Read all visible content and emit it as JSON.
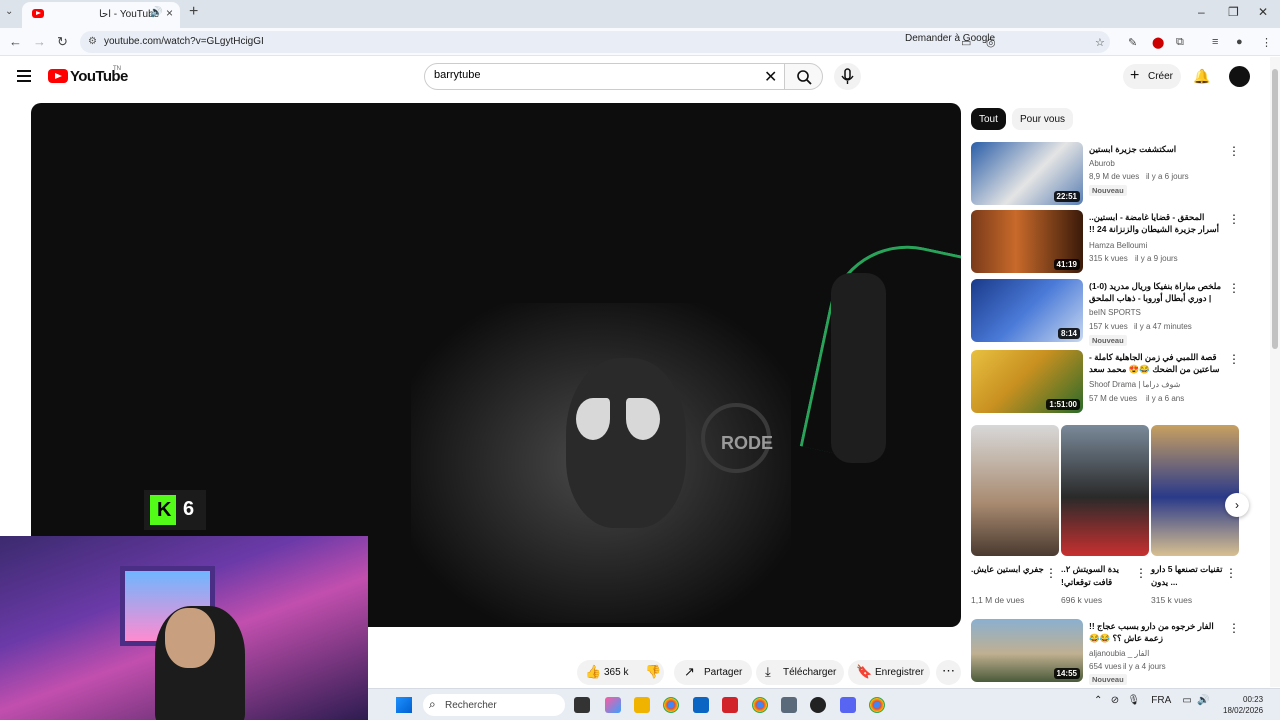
{
  "browser": {
    "tab_title": "YouTube - احا",
    "url": "youtube.com/watch?v=GLgytHcigGI",
    "ask_google": "Demander à Google"
  },
  "youtube": {
    "logo_text": "YouTube",
    "country_code": "TN",
    "search_value": "barrytube",
    "create_label": "Créer"
  },
  "video": {
    "overlay_counter": "6",
    "mic_brand": "RODE"
  },
  "actions": {
    "likes": "365 k",
    "share": "Partager",
    "download": "Télécharger",
    "save": "Enregistrer"
  },
  "chips": [
    "Tout",
    "Pour vous"
  ],
  "recommendations": [
    {
      "title": "اسكتشفت جزيرة ابستين",
      "channel": "Aburob",
      "verified": true,
      "views": "8,9 M de vues",
      "age": "il y a 6 jours",
      "duration": "22:51",
      "badge": "Nouveau"
    },
    {
      "title": "المحقق - قضايا غامضة - ابستين.. أسرار جزيرة الشيطان والزنزانة 24 !!",
      "channel": "Hamza Belloumi",
      "verified": true,
      "views": "315 k vues",
      "age": "il y a 9 jours",
      "duration": "41:19",
      "badge": ""
    },
    {
      "title": "ملخص مباراة بنفيكا وريال مدريد (0-1) | دوري أبطال أوروبا - ذهاب الملحق المؤهل...",
      "channel": "beIN SPORTS",
      "verified": true,
      "views": "157 k vues",
      "age": "il y a 47 minutes",
      "duration": "8:14",
      "badge": "Nouveau"
    },
    {
      "title": "قصة اللمبي في زمن الجاهلية كاملة - ساعتين من الضحك 😂😍 محمد سعد - فيلم اطاط",
      "channel": "Shoof Drama | شوف دراما",
      "verified": true,
      "views": "57 M de vues",
      "age": "il y a 6 ans",
      "duration": "1:51:00",
      "badge": ""
    }
  ],
  "shorts": [
    {
      "title": "جفري ابستين عايش.",
      "views": "1,1 M de vues"
    },
    {
      "title": "يدة السويتش ٢.. قافت توقعاتي!",
      "views": "696 k vues"
    },
    {
      "title": "تقنيات تصنعها 5 دارو ... يدون",
      "views": "315 k vues"
    }
  ],
  "last_recommendation": {
    "title": "الفار خرجوه من دارو بسبب عجاج !! زعمة عاش ؟؟ 😂😂",
    "channel": "aljanoubia _ الفار",
    "views": "654 vues",
    "age": "il y a 4 jours",
    "duration": "14:55",
    "badge": "Nouveau"
  },
  "taskbar": {
    "search_placeholder": "Rechercher",
    "language": "FRA",
    "time": "00:23",
    "date": "18/02/2026"
  },
  "colors": {
    "youtube_red": "#ff0000",
    "kick_green": "#53fc18",
    "chip_active": "#0f0f0f"
  },
  "icons": [
    "menu-icon",
    "search-icon",
    "mic-icon",
    "bell-icon",
    "like-icon",
    "dislike-icon",
    "share-icon",
    "download-icon",
    "save-icon",
    "more-icon"
  ]
}
